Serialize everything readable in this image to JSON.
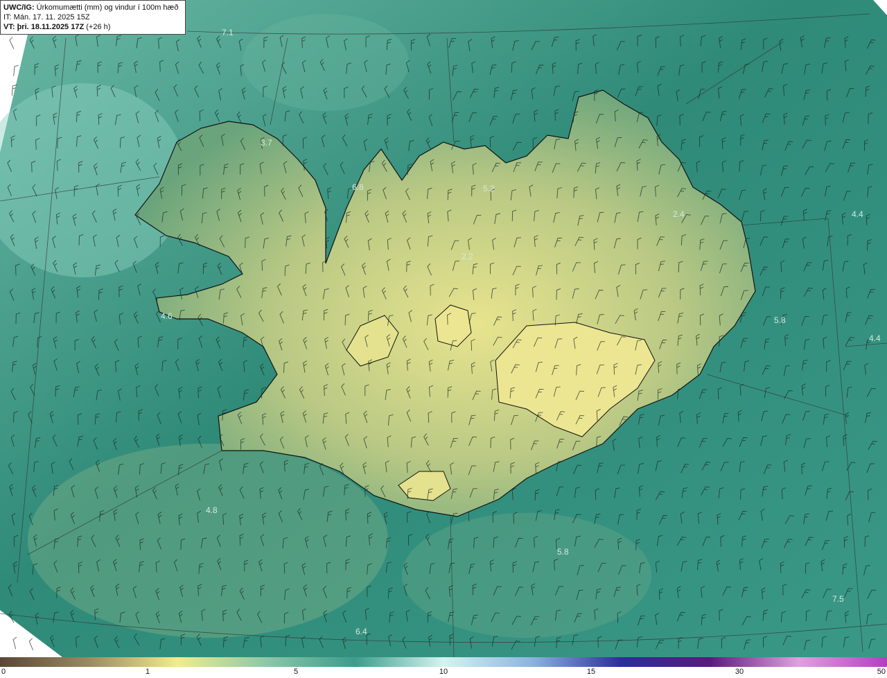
{
  "header": {
    "model": "UWC/IG:",
    "title": "Úrkomumætti (mm) og vindur í 100m hæð",
    "it_line": "IT: Mán. 17. 11. 2025 15Z",
    "vt_prefix": "VT:",
    "vt_bold": "þri. 18.11.2025 17Z",
    "vt_suffix": "(+26 h)"
  },
  "map_labels": [
    "7.1",
    "3.7",
    "6.8",
    "5.2",
    "2.4",
    "4.4",
    "2.2",
    "4.6",
    "5.8",
    "4.4",
    "4.8",
    "5.8",
    "7.5",
    "6.4"
  ],
  "colorbar": {
    "ticks": [
      "0",
      "1",
      "5",
      "10",
      "15",
      "30",
      "50"
    ],
    "tick_values": [
      0,
      1,
      5,
      10,
      15,
      30,
      50
    ],
    "colors": [
      "#5a4636",
      "#9a8a62",
      "#f2ec8c",
      "#8cc8a8",
      "#3c9c8c",
      "#d4f4f0",
      "#8cb4e0",
      "#2c2c9c",
      "#5a1a7c",
      "#e0a0e0",
      "#b040c0"
    ]
  },
  "colors": {
    "sea_teal": "#2f8a78",
    "land_yellow": "#e6e28c",
    "land_green": "#8ab878",
    "coast": "#111111"
  }
}
